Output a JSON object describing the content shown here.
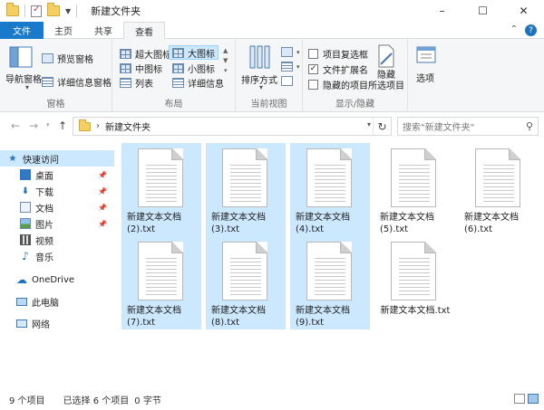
{
  "window": {
    "title": "新建文件夹",
    "controls": {
      "minimize": "–",
      "maximize": "☐",
      "close": "✕"
    }
  },
  "ribbon_tabs": [
    {
      "label": "文件"
    },
    {
      "label": "主页"
    },
    {
      "label": "共享"
    },
    {
      "label": "查看"
    }
  ],
  "ribbon": {
    "pane_group": {
      "label": "窗格",
      "nav_pane": "导航窗格",
      "preview_pane": "预览窗格",
      "details_pane": "详细信息窗格"
    },
    "layout_group": {
      "label": "布局",
      "xlarge_icons": "超大图标",
      "large_icons": "大图标",
      "medium_icons": "中图标",
      "small_icons": "小图标",
      "list": "列表",
      "details": "详细信息"
    },
    "current_view_group": {
      "label": "当前视图",
      "sort_by": "排序方式"
    },
    "show_hide_group": {
      "label": "显示/隐藏",
      "item_checkboxes": "项目复选框",
      "file_extensions": "文件扩展名",
      "hidden_items": "隐藏的项目",
      "hide_selected_line1": "隐藏",
      "hide_selected_line2": "所选项目"
    },
    "options": "选项"
  },
  "address_bar": {
    "path": "新建文件夹",
    "search_placeholder": "搜索\"新建文件夹\""
  },
  "nav_pane": {
    "quick_access": "快速访问",
    "items": [
      {
        "label": "桌面"
      },
      {
        "label": "下载"
      },
      {
        "label": "文档"
      },
      {
        "label": "图片"
      },
      {
        "label": "视频"
      },
      {
        "label": "音乐"
      }
    ],
    "onedrive": "OneDrive",
    "this_pc": "此电脑",
    "network": "网络"
  },
  "files": [
    {
      "name": "新建文本文档 (2).txt",
      "selected": true
    },
    {
      "name": "新建文本文档 (3).txt",
      "selected": true
    },
    {
      "name": "新建文本文档 (4).txt",
      "selected": true
    },
    {
      "name": "新建文本文档 (5).txt",
      "selected": false
    },
    {
      "name": "新建文本文档 (6).txt",
      "selected": false
    },
    {
      "name": "新建文本文档 (7).txt",
      "selected": true
    },
    {
      "name": "新建文本文档 (8).txt",
      "selected": true
    },
    {
      "name": "新建文本文档 (9).txt",
      "selected": true
    },
    {
      "name": "新建文本文档.txt",
      "selected": false
    }
  ],
  "status_bar": {
    "item_count": "9 个项目",
    "selection": "已选择 6 个项目",
    "size": "0 字节"
  },
  "colors": {
    "file_tab": "#1979ca",
    "selection": "#cce8ff",
    "ribbon_bg": "#f5f6f7"
  }
}
